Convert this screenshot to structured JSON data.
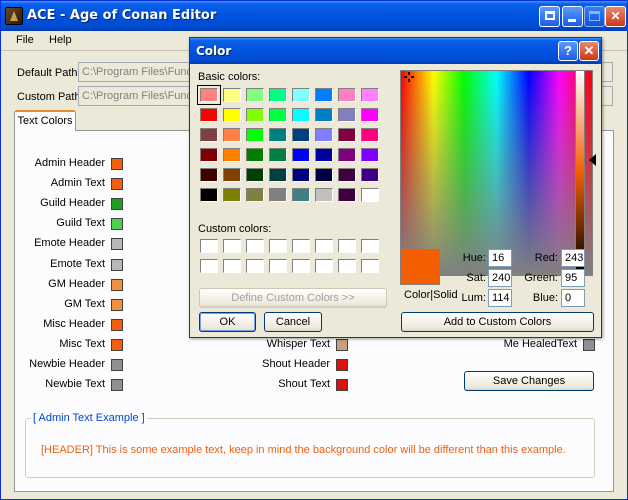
{
  "window": {
    "title": "ACE - Age of Conan Editor"
  },
  "menu": {
    "items": [
      "File",
      "Help"
    ]
  },
  "paths": {
    "default_label": "Default Path",
    "default_value": "C:\\Program Files\\Funcom",
    "custom_label": "Custom Path",
    "custom_value": "C:\\Program Files\\Funcom"
  },
  "tabs": {
    "active": "Text Colors"
  },
  "left_colors": [
    {
      "label": "Admin Header",
      "color": "#f06010"
    },
    {
      "label": "Admin Text",
      "color": "#f06010"
    },
    {
      "label": "Guild Header",
      "color": "#20a020"
    },
    {
      "label": "Guild Text",
      "color": "#50d050"
    },
    {
      "label": "Emote Header",
      "color": "#b8b8b8"
    },
    {
      "label": "Emote Text",
      "color": "#b8b8b8"
    },
    {
      "label": "GM Header",
      "color": "#f09040"
    },
    {
      "label": "GM Text",
      "color": "#f09040"
    },
    {
      "label": "Misc Header",
      "color": "#f06010"
    },
    {
      "label": "Misc Text",
      "color": "#f06010"
    },
    {
      "label": "Newbie Header",
      "color": "#909090"
    },
    {
      "label": "Newbie Text",
      "color": "#909090"
    }
  ],
  "middle_colors": [
    {
      "label": "Whisper Text",
      "color": "#c8a080"
    },
    {
      "label": "Shout Header",
      "color": "#e01010"
    },
    {
      "label": "Shout Text",
      "color": "#e01010"
    }
  ],
  "right_colors": [
    {
      "label": "Me HealedText",
      "color": "#909090"
    }
  ],
  "save_button": "Save Changes",
  "example": {
    "group_title": "[ Admin Text Example ]",
    "text": "[HEADER]  This is some example text, keep in mind the background color will be different than this example."
  },
  "color_dialog": {
    "title": "Color",
    "basic_colors_label": "Basic colors:",
    "custom_colors_label": "Custom colors:",
    "define_custom_button": "Define Custom Colors >>",
    "ok_button": "OK",
    "cancel_button": "Cancel",
    "add_custom_button": "Add to Custom Colors",
    "color_solid_label": "Color|Solid",
    "current_color": "#f35f00",
    "fields": {
      "hue_label": "Hue:",
      "hue": "16",
      "sat_label": "Sat:",
      "sat": "240",
      "lum_label": "Lum:",
      "lum": "114",
      "red_label": "Red:",
      "red": "243",
      "green_label": "Green:",
      "green": "95",
      "blue_label": "Blue:",
      "blue": "0"
    },
    "basic_colors": [
      "#ff8080",
      "#ffff80",
      "#80ff80",
      "#00ff80",
      "#80ffff",
      "#0080ff",
      "#ff80c0",
      "#ff80ff",
      "#ff0000",
      "#ffff00",
      "#80ff00",
      "#00ff40",
      "#00ffff",
      "#0080c0",
      "#8080c0",
      "#ff00ff",
      "#804040",
      "#ff8040",
      "#00ff00",
      "#008080",
      "#004080",
      "#8080ff",
      "#800040",
      "#ff0080",
      "#800000",
      "#ff8000",
      "#008000",
      "#008040",
      "#0000ff",
      "#0000a0",
      "#800080",
      "#8000ff",
      "#400000",
      "#804000",
      "#004000",
      "#004040",
      "#000080",
      "#000040",
      "#400040",
      "#400080",
      "#000000",
      "#808000",
      "#808040",
      "#808080",
      "#408080",
      "#c0c0c0",
      "#400040",
      "#ffffff"
    ],
    "custom_colors": [
      "#ffffff",
      "#ffffff",
      "#ffffff",
      "#ffffff",
      "#ffffff",
      "#ffffff",
      "#ffffff",
      "#ffffff",
      "#ffffff",
      "#ffffff",
      "#ffffff",
      "#ffffff",
      "#ffffff",
      "#ffffff",
      "#ffffff",
      "#ffffff"
    ]
  }
}
